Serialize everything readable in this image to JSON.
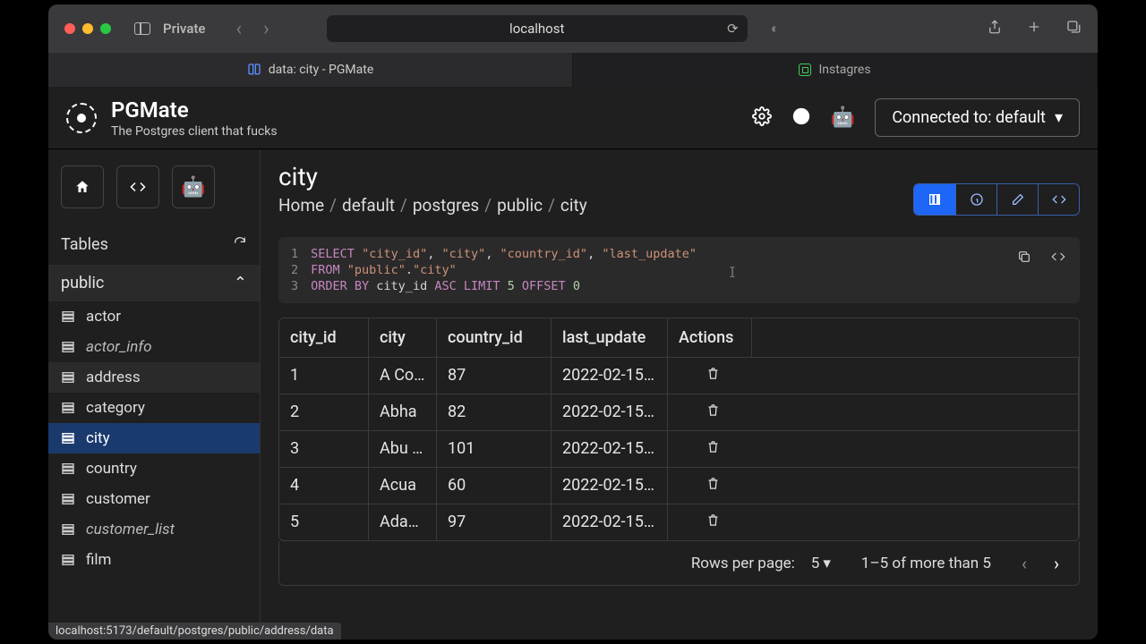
{
  "browser": {
    "private_label": "Private",
    "url": "localhost",
    "tabs": [
      {
        "label": "data: city - PGMate",
        "active": true
      },
      {
        "label": "Instagres",
        "active": false
      }
    ],
    "status_url": "localhost:5173/default/postgres/public/address/data"
  },
  "app": {
    "name": "PGMate",
    "tagline": "The Postgres client that fucks",
    "connection_label": "Connected to: default"
  },
  "sidebar": {
    "section_label": "Tables",
    "schema": "public",
    "tables": [
      {
        "name": "actor",
        "view": false
      },
      {
        "name": "actor_info",
        "view": true
      },
      {
        "name": "address",
        "view": false,
        "hover": true
      },
      {
        "name": "category",
        "view": false
      },
      {
        "name": "city",
        "view": false,
        "active": true
      },
      {
        "name": "country",
        "view": false
      },
      {
        "name": "customer",
        "view": false
      },
      {
        "name": "customer_list",
        "view": true
      },
      {
        "name": "film",
        "view": false
      }
    ]
  },
  "page": {
    "title": "city",
    "breadcrumb": [
      "Home",
      "default",
      "postgres",
      "public",
      "city"
    ]
  },
  "sql": {
    "lines": [
      [
        {
          "t": "SELECT",
          "c": "kw"
        },
        {
          "t": " ",
          "c": "plain"
        },
        {
          "t": "\"city_id\"",
          "c": "str"
        },
        {
          "t": ", ",
          "c": "plain"
        },
        {
          "t": "\"city\"",
          "c": "str"
        },
        {
          "t": ", ",
          "c": "plain"
        },
        {
          "t": "\"country_id\"",
          "c": "str"
        },
        {
          "t": ", ",
          "c": "plain"
        },
        {
          "t": "\"last_update\"",
          "c": "str"
        }
      ],
      [
        {
          "t": "FROM",
          "c": "kw"
        },
        {
          "t": " ",
          "c": "plain"
        },
        {
          "t": "\"public\"",
          "c": "str"
        },
        {
          "t": ".",
          "c": "plain"
        },
        {
          "t": "\"city\"",
          "c": "str"
        }
      ],
      [
        {
          "t": "ORDER BY",
          "c": "kw"
        },
        {
          "t": " city_id ",
          "c": "plain"
        },
        {
          "t": "ASC",
          "c": "kw"
        },
        {
          "t": " ",
          "c": "plain"
        },
        {
          "t": "LIMIT",
          "c": "kw"
        },
        {
          "t": " ",
          "c": "plain"
        },
        {
          "t": "5",
          "c": "num"
        },
        {
          "t": " ",
          "c": "plain"
        },
        {
          "t": "OFFSET",
          "c": "kw"
        },
        {
          "t": " ",
          "c": "plain"
        },
        {
          "t": "0",
          "c": "num"
        }
      ]
    ]
  },
  "table": {
    "columns": [
      "city_id",
      "city",
      "country_id",
      "last_update",
      "Actions"
    ],
    "rows": [
      {
        "city_id": "1",
        "city": "A Co…",
        "country_id": "87",
        "last_update": "2022-02-15…"
      },
      {
        "city_id": "2",
        "city": "Abha",
        "country_id": "82",
        "last_update": "2022-02-15…"
      },
      {
        "city_id": "3",
        "city": "Abu …",
        "country_id": "101",
        "last_update": "2022-02-15…"
      },
      {
        "city_id": "4",
        "city": "Acua",
        "country_id": "60",
        "last_update": "2022-02-15…"
      },
      {
        "city_id": "5",
        "city": "Ada…",
        "country_id": "97",
        "last_update": "2022-02-15…"
      }
    ]
  },
  "pagination": {
    "rpp_label": "Rows per page:",
    "rpp_value": "5",
    "range_label": "1–5 of more than 5"
  }
}
